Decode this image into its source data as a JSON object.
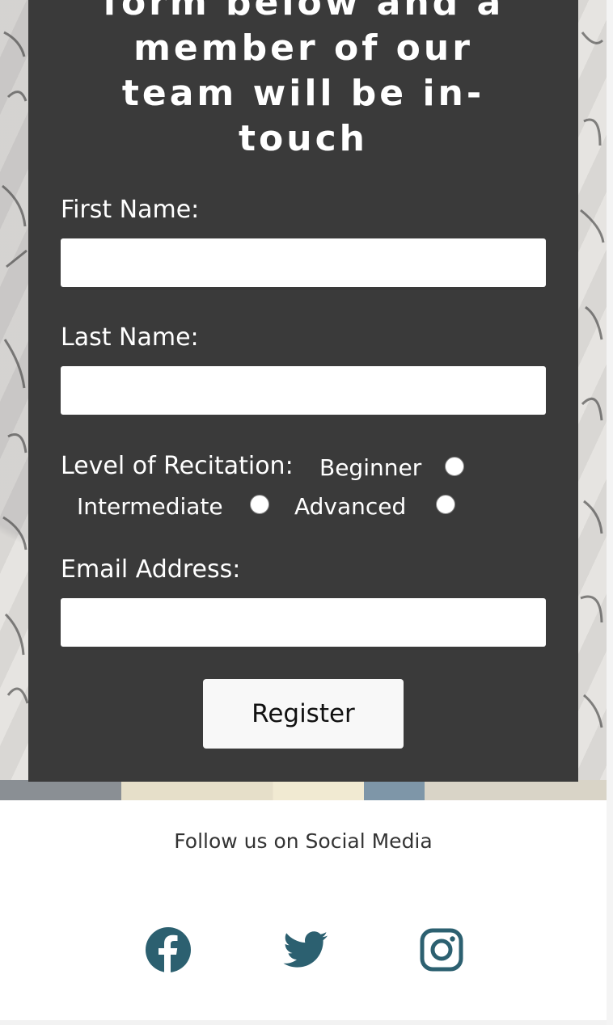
{
  "form": {
    "heading_lines": [
      "form below and a",
      "member of our",
      "team will be in-",
      "touch"
    ],
    "first_name_label": "First Name:",
    "first_name_value": "",
    "last_name_label": "Last Name:",
    "last_name_value": "",
    "level_label": "Level of Recitation:",
    "level_options": [
      "Beginner",
      "Intermediate",
      "Advanced"
    ],
    "email_label": "Email Address:",
    "email_value": "",
    "submit_label": "Register"
  },
  "footer": {
    "follow_text": "Follow us on Social Media",
    "social_icons": [
      "facebook-icon",
      "twitter-icon",
      "instagram-icon"
    ],
    "icon_color": "#2c6070"
  },
  "colors": {
    "panel": "#3a3a3a",
    "button_bg": "#f8f8f8",
    "text_light": "#ffffff"
  }
}
